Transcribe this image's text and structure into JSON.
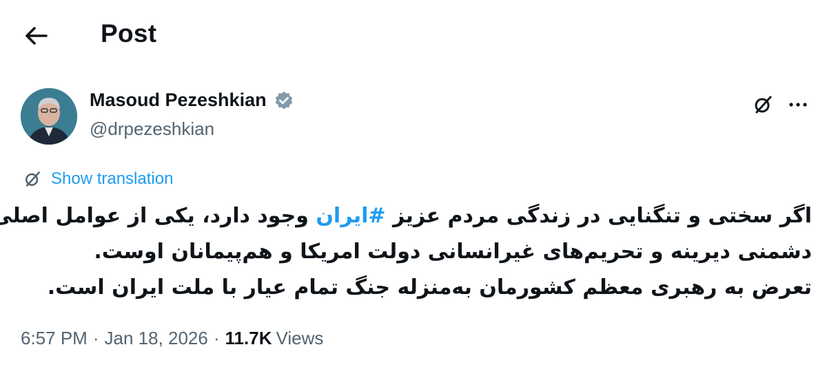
{
  "header": {
    "title": "Post",
    "back_icon": "arrow-left-icon"
  },
  "author": {
    "name": "Masoud Pezeshkian",
    "handle": "@drpezeshkian",
    "verified_color": "#829aab"
  },
  "actions": {
    "grok_icon": "grok-icon",
    "more_label": "···"
  },
  "translation": {
    "label": "Show translation"
  },
  "tweet": {
    "line1_before": "اگر سختی و تنگنایی در زندگی مردم عزیز ",
    "hashtag": "#ایران",
    "line1_after": " وجود دارد، یکی از عوامل اصلی آن",
    "line2": "دشمنی دیرینه و تحریم‌های غیرانسانی دولت امریکا و هم‌پیمانان اوست.",
    "line3": "تعرض به رهبری معظم کشورمان به‌منزله جنگ تمام عیار با ملت ایران است."
  },
  "meta": {
    "time": "6:57 PM",
    "separator": "·",
    "date": "Jan 18, 2026",
    "views_count": "11.7K",
    "views_label": "Views"
  },
  "colors": {
    "accent": "#1d9bf0",
    "secondary_text": "#536471",
    "primary_text": "#0f1419"
  }
}
